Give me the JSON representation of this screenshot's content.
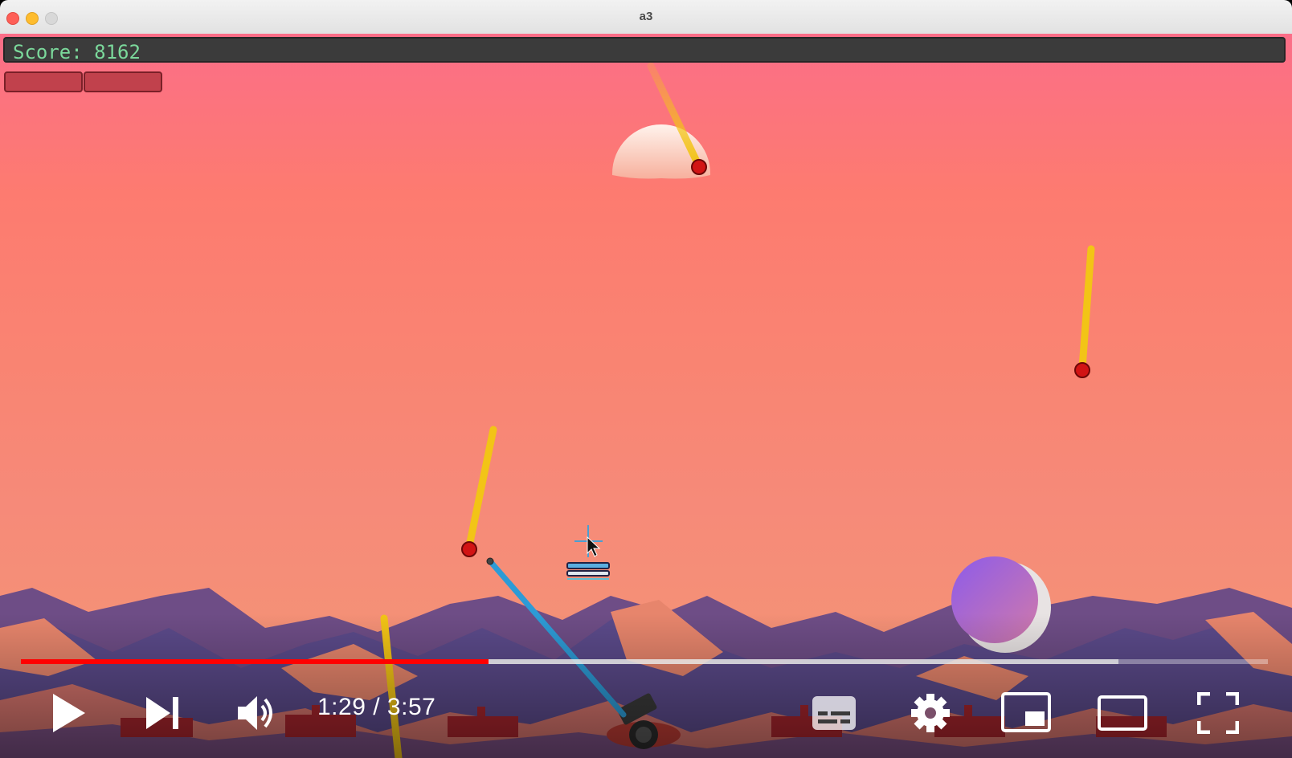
{
  "window": {
    "title": "a3"
  },
  "game": {
    "score_text": "Score: 8162",
    "health_segments": 2
  },
  "player": {
    "current_time": "1:29",
    "separator": "/",
    "duration": "3:57",
    "progress_played": 0.375,
    "progress_buffered": 0.88
  },
  "icons": {
    "play": "play-icon",
    "next": "next-icon",
    "volume": "volume-icon",
    "subtitles": "subtitles-icon",
    "settings": "gear-icon",
    "miniplayer": "miniplayer-icon",
    "theater": "theater-mode-icon",
    "fullscreen": "fullscreen-icon"
  },
  "colors": {
    "progress_played": "#ff0000",
    "score_text": "#7bd89b",
    "health": "#c1414c",
    "missile_trail": "#f2c416",
    "missile_head": "#d21414",
    "interceptor": "#2d9bd6"
  }
}
